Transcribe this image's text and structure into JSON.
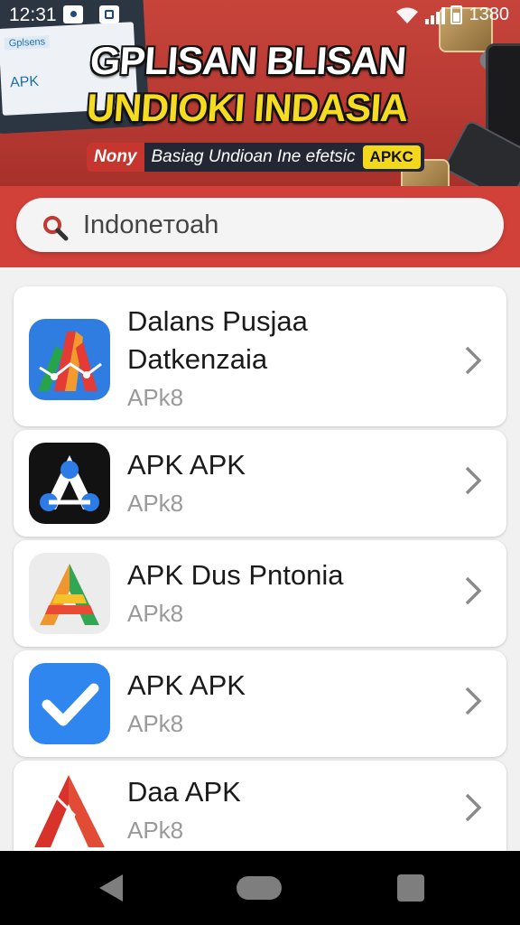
{
  "status_bar": {
    "time": "12:31",
    "battery_text": "1380"
  },
  "banner": {
    "laptop_tag": "Gplsens",
    "laptop_apk": "APK",
    "title_line1": "GPLISAN BLISAN",
    "title_line2": "UNDIOKI INDASIA",
    "sub_left": "Nony",
    "sub_mid": "Basiag Undioan Ine efetsic",
    "sub_right": "APKC",
    "colors": {
      "banner_red": "#c7443b",
      "title_yellow": "#f6dc21"
    }
  },
  "search": {
    "value": "Indoneтoah"
  },
  "apps": [
    {
      "title_line1": "Dalans Pusjaa",
      "title_line2": "Datkenzaia",
      "subtitle": "APk8",
      "icon": "app-icon-a-blue-red"
    },
    {
      "title_line1": "APK APK",
      "subtitle": "APk8",
      "icon": "app-icon-a-black-nodes"
    },
    {
      "title_line1": "APK Dus Pntonia",
      "subtitle": "APk8",
      "icon": "app-icon-a-orange-green"
    },
    {
      "title_line1": "APK APK",
      "subtitle": "APk8",
      "icon": "app-icon-checkmark-blue"
    },
    {
      "title_line1": "Daa APK",
      "subtitle": "APk8",
      "icon": "app-icon-a-red"
    }
  ],
  "nav": {
    "back": "back-icon",
    "home": "home-icon",
    "recents": "recents-icon"
  }
}
